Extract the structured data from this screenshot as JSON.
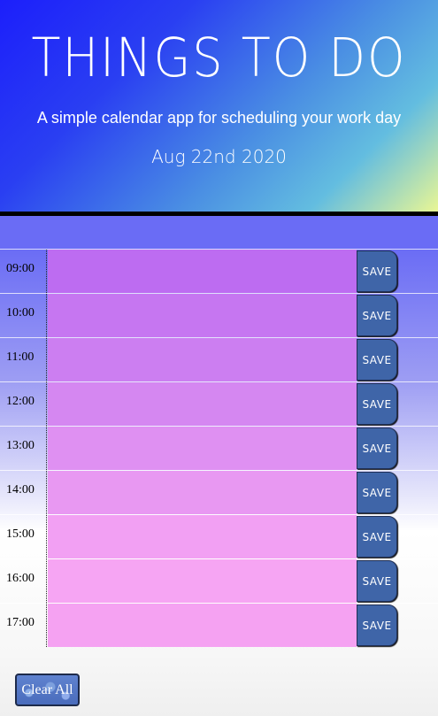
{
  "header": {
    "title": "THINGS TO DO",
    "subtitle": "A simple calendar app for scheduling your work day",
    "date": "Aug 22nd 2020"
  },
  "timeblocks": [
    {
      "hour": "09:00",
      "color": "#bd6cf1",
      "save_label": "SAVE",
      "text": ""
    },
    {
      "hour": "10:00",
      "color": "#c676f1",
      "save_label": "SAVE",
      "text": ""
    },
    {
      "hour": "11:00",
      "color": "#cc7ef1",
      "save_label": "SAVE",
      "text": ""
    },
    {
      "hour": "12:00",
      "color": "#d587f1",
      "save_label": "SAVE",
      "text": ""
    },
    {
      "hour": "13:00",
      "color": "#df90f2",
      "save_label": "SAVE",
      "text": ""
    },
    {
      "hour": "14:00",
      "color": "#e898f2",
      "save_label": "SAVE",
      "text": ""
    },
    {
      "hour": "15:00",
      "color": "#f2a0f3",
      "save_label": "SAVE",
      "text": ""
    },
    {
      "hour": "16:00",
      "color": "#f6a5f3",
      "save_label": "SAVE",
      "text": ""
    },
    {
      "hour": "17:00",
      "color": "#f5a2f2",
      "save_label": "SAVE",
      "text": ""
    }
  ],
  "clear_button": {
    "label": "Clear All"
  },
  "colors": {
    "header_gradient_start": "#1c1ffb",
    "header_gradient_end": "#e9f694",
    "save_button": "#3f65a8"
  }
}
